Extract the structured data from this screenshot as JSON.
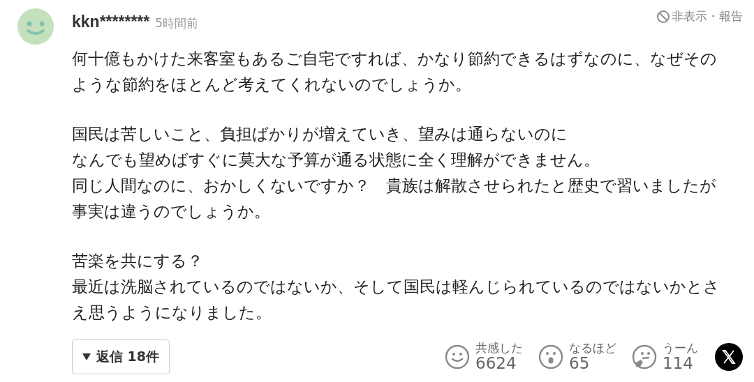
{
  "comment": {
    "user": "kkn********",
    "time": "5時間前",
    "hide_report": "非表示・報告",
    "paragraphs": [
      {
        "lines": [
          "何十億もかけた来客室もあるご自宅ですれば、かなり節約できるはずなのに、なぜその",
          "ような節約をほとんど考えてくれないのでしょうか。"
        ]
      },
      {
        "lines": [
          "国民は苦しいこと、負担ばかりが増えていき、望みは通らないのに",
          "なんでも望めばすぐに莫大な予算が通る状態に全く理解ができません。",
          "同じ人間なのに、おかしくないですか？　貴族は解散させられたと歴史で習いましたが",
          "事実は違うのでしょうか。"
        ]
      },
      {
        "lines": [
          "苦楽を共にする？",
          "最近は洗脳されているのではないか、そして国民は軽んじられているのではないかとさ",
          "え思うようになりました。"
        ]
      }
    ],
    "replies": {
      "label": "返信 18件",
      "expanded": false
    },
    "reactions": [
      {
        "kind": "smile",
        "label": "共感した",
        "count": "6624"
      },
      {
        "kind": "surprised",
        "label": "なるほど",
        "count": "65"
      },
      {
        "kind": "thinking",
        "label": "うーん",
        "count": "114"
      }
    ]
  }
}
